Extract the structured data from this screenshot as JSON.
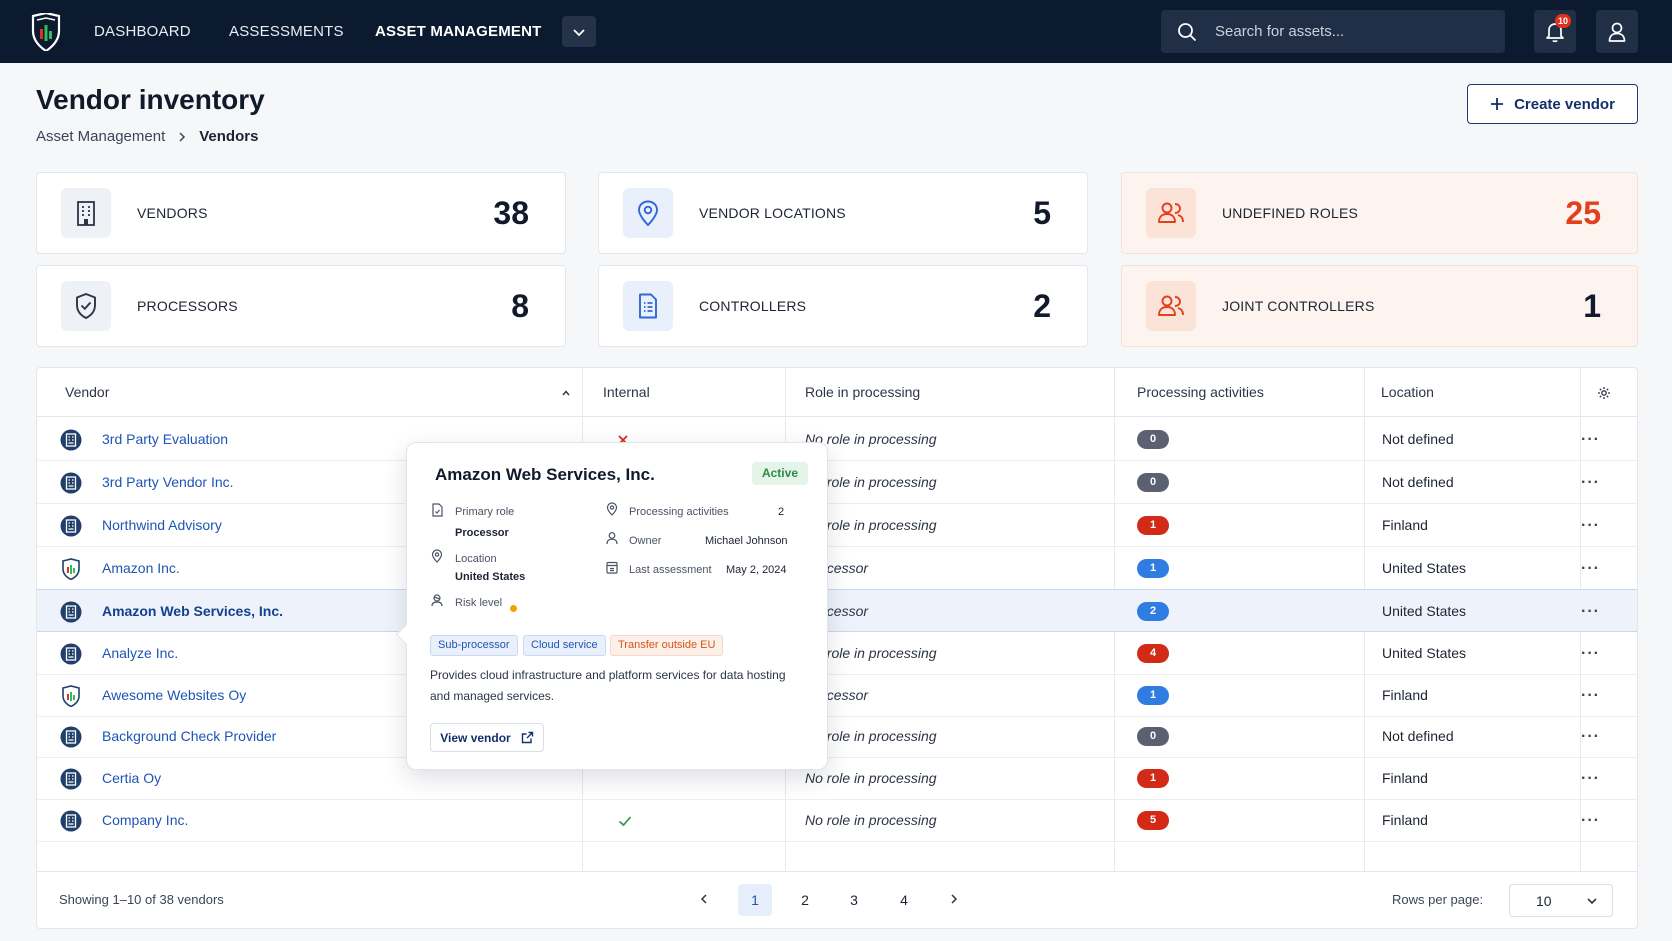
{
  "nav": {
    "items": [
      {
        "label": "DASHBOARD",
        "active": false
      },
      {
        "label": "ASSESSMENTS",
        "active": false
      },
      {
        "label": "ASSET MANAGEMENT",
        "active": true
      }
    ],
    "dropdown_icon": "chevron-down-icon"
  },
  "search": {
    "placeholder": "Search for assets..."
  },
  "notifications": {
    "count": "10"
  },
  "page": {
    "title": "Vendor inventory",
    "breadcrumb": [
      "Asset Management",
      "Vendors"
    ],
    "create_label": "Create vendor"
  },
  "stats": [
    {
      "label": "VENDORS",
      "value": "38",
      "icon": "building-icon"
    },
    {
      "label": "VENDOR LOCATIONS",
      "value": "5",
      "icon": "map-pin-icon"
    },
    {
      "label": "UNDEFINED ROLES",
      "value": "25",
      "icon": "users-icon"
    },
    {
      "label": "PROCESSORS",
      "value": "8",
      "icon": "shield-check-icon"
    },
    {
      "label": "CONTROLLERS",
      "value": "2",
      "icon": "document-icon"
    },
    {
      "label": "JOINT CONTROLLERS",
      "value": "1",
      "icon": "users-icon"
    }
  ],
  "table": {
    "columns": [
      "Vendor",
      "Internal",
      "Role in processing",
      "Processing activities",
      "Location"
    ],
    "rows": [
      {
        "name": "3rd Party Evaluation",
        "internal": "no",
        "role": "No role in processing",
        "activities": "0",
        "badge": "grey",
        "location": "Not defined",
        "icon": "building"
      },
      {
        "name": "3rd Party Vendor Inc.",
        "internal": "",
        "role": "No role in processing",
        "activities": "0",
        "badge": "grey",
        "location": "Not defined",
        "icon": "building"
      },
      {
        "name": "Northwind Advisory",
        "internal": "",
        "role": "No role in processing",
        "activities": "1",
        "badge": "red",
        "location": "Finland",
        "icon": "building"
      },
      {
        "name": "Amazon Inc.",
        "internal": "",
        "role": "Processor",
        "activities": "1",
        "badge": "blue",
        "location": "United States",
        "icon": "shield"
      },
      {
        "name": "Amazon Web Services, Inc.",
        "internal": "",
        "role": "Processor",
        "activities": "2",
        "badge": "blue",
        "location": "United States",
        "icon": "building",
        "selected": true
      },
      {
        "name": "Analyze Inc.",
        "internal": "",
        "role": "No role in processing",
        "activities": "4",
        "badge": "red",
        "location": "United States",
        "icon": "building"
      },
      {
        "name": "Awesome Websites Oy",
        "internal": "",
        "role": "Processor",
        "activities": "1",
        "badge": "blue",
        "location": "Finland",
        "icon": "shield"
      },
      {
        "name": "Background Check Provider",
        "internal": "",
        "role": "No role in processing",
        "activities": "0",
        "badge": "grey",
        "location": "Not defined",
        "icon": "building"
      },
      {
        "name": "Certia Oy",
        "internal": "",
        "role": "No role in processing",
        "activities": "1",
        "badge": "red",
        "location": "Finland",
        "icon": "building"
      },
      {
        "name": "Company Inc.",
        "internal": "yes",
        "role": "No role in processing",
        "activities": "5",
        "badge": "red",
        "location": "Finland",
        "icon": "building"
      }
    ],
    "showing": "Showing 1–10 of 38 vendors",
    "pages": [
      "1",
      "2",
      "3",
      "4"
    ],
    "current_page": "1",
    "rows_per_page_label": "Rows per page:",
    "rows_per_page": "10"
  },
  "popover": {
    "title": "Amazon Web Services, Inc.",
    "status": "Active",
    "primary_role_label": "Primary role",
    "primary_role": "Processor",
    "location_label": "Location",
    "location": "United States",
    "risk_label": "Risk level",
    "activities_label": "Processing activities",
    "activities": "2",
    "owner_label": "Owner",
    "owner": "Michael Johnson",
    "assessment_label": "Last assessment",
    "assessment": "May 2, 2024",
    "tags": [
      "Sub-processor",
      "Cloud service",
      "Transfer outside EU"
    ],
    "description": "Provides cloud infrastructure and platform services for data hosting and managed services.",
    "view_label": "View vendor"
  },
  "colors": {
    "topbar": "#0c1a30",
    "link": "#1e55b4",
    "danger": "#d22a17",
    "info": "#2f7de1",
    "warning_card": "#fdf4ef"
  }
}
